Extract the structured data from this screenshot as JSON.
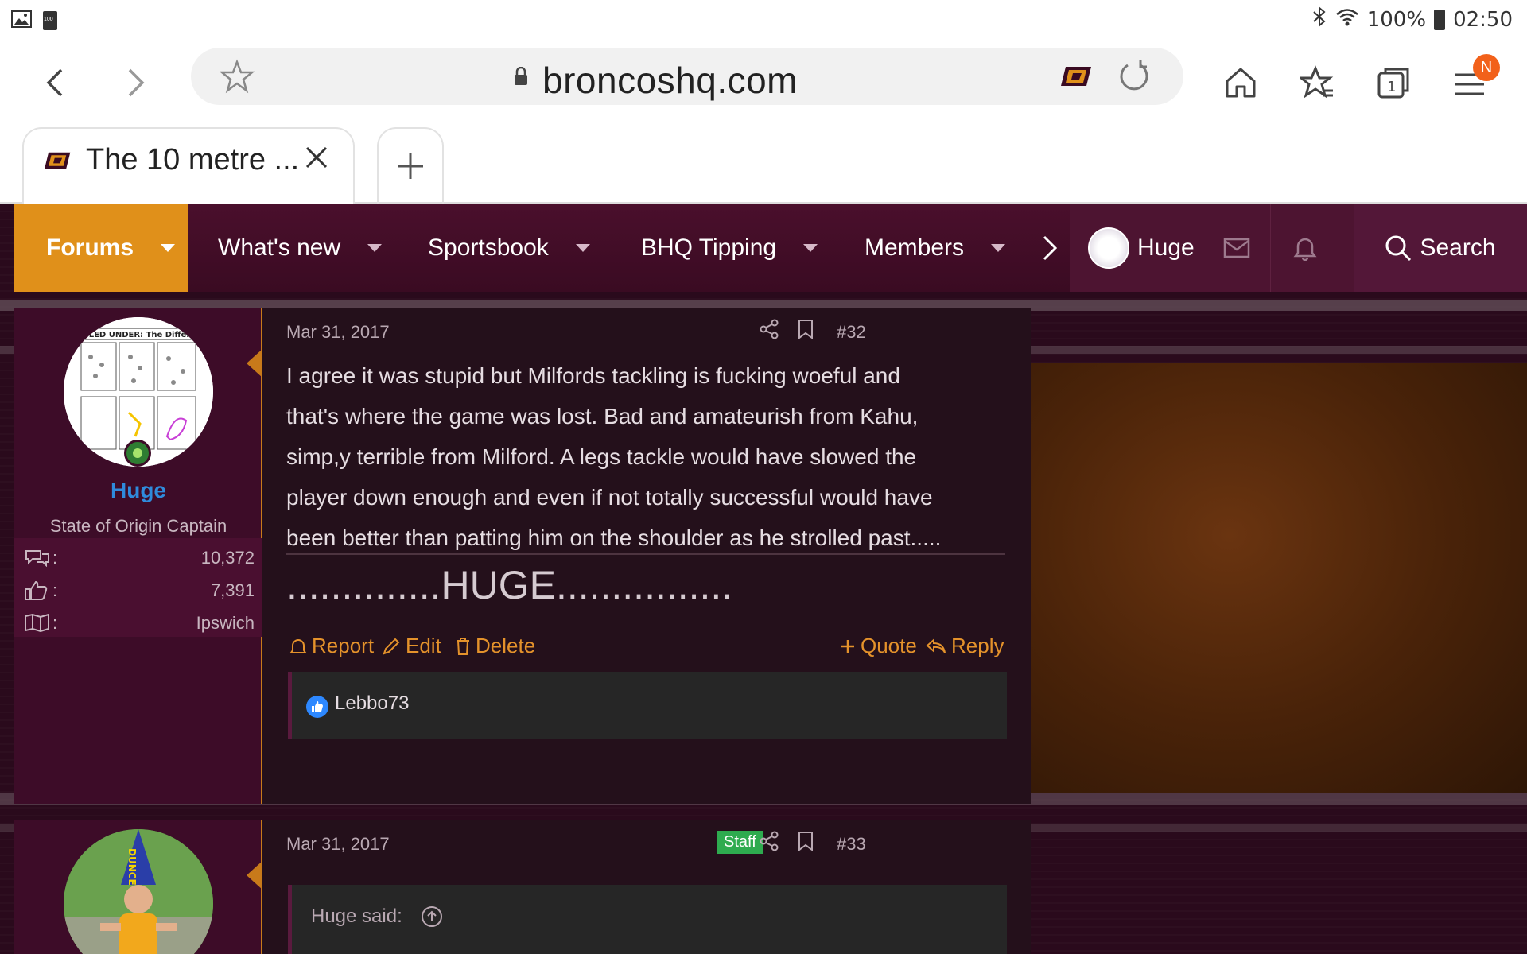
{
  "status": {
    "battery_small": "100",
    "battery_pct": "100%",
    "time": "02:50"
  },
  "browser": {
    "url": "broncoshq.com",
    "tab_title": "The 10 metre ...",
    "menu_badge": "N"
  },
  "nav": {
    "items": [
      {
        "label": "Forums"
      },
      {
        "label": "What's new"
      },
      {
        "label": "Sportsbook"
      },
      {
        "label": "BHQ Tipping"
      },
      {
        "label": "Members"
      }
    ],
    "username": "Huge",
    "search_label": "Search"
  },
  "post32": {
    "date": "Mar 31, 2017",
    "number": "#32",
    "author": "Huge",
    "title": "State of Origin Captain",
    "stats": [
      {
        "icon": "messages-icon",
        "value": "10,372"
      },
      {
        "icon": "likes-icon",
        "value": "7,391"
      },
      {
        "icon": "location-icon",
        "value": "Ipswich"
      }
    ],
    "body_lines": [
      "I agree it was stupid but Milfords tackling is fucking woeful and",
      "that's where the game was lost. Bad and amateurish from Kahu,",
      "simp,y terrible from Milford. A legs tackle would have slowed the",
      "player down enough and even if not totally successful would have",
      "been better than patting him on the shoulder as he strolled past....."
    ],
    "signature": "..............HUGE................",
    "actions": {
      "report": "Report",
      "edit": "Edit",
      "delete": "Delete",
      "quote": "Quote",
      "reply": "Reply"
    },
    "reaction_user": "Lebbo73",
    "avatar_caption": "ILED UNDER: The Difference"
  },
  "post33": {
    "date": "Mar 31, 2017",
    "badge": "Staff",
    "number": "#33",
    "quote_author": "Huge said:",
    "hat_text": "DUNCE"
  },
  "colors": {
    "accent": "#e4922b",
    "nav_active": "#e0901a",
    "username": "#2f8bdc",
    "staff": "#2eab4f"
  }
}
